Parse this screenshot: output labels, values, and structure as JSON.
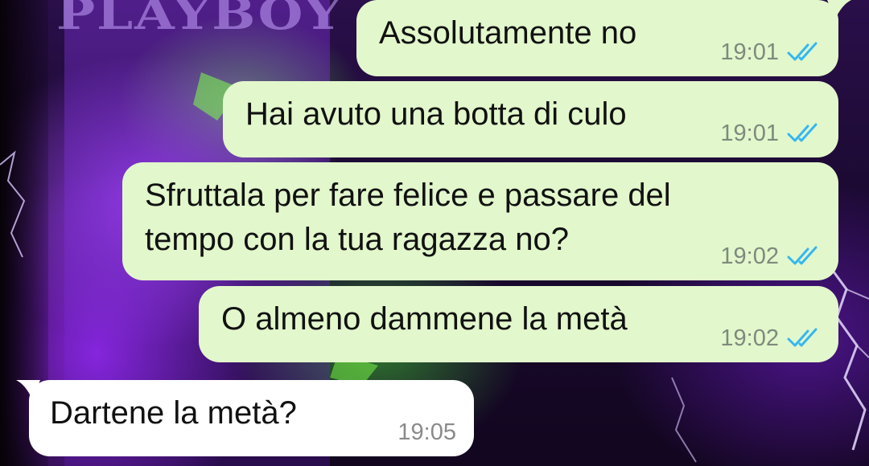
{
  "wallpaper": {
    "title": "PLAYBOY"
  },
  "colors": {
    "outgoing_bubble": "#e2f7cb",
    "incoming_bubble": "#ffffff",
    "read_ticks": "#34b7f1",
    "timestamp": "#7e8a7e"
  },
  "messages": [
    {
      "direction": "outgoing",
      "text": "Assolutamente no",
      "time": "19:01",
      "status_icon": "double-check-read-icon"
    },
    {
      "direction": "outgoing",
      "text": "Hai avuto una botta di culo",
      "time": "19:01",
      "status_icon": "double-check-read-icon"
    },
    {
      "direction": "outgoing",
      "text": "Sfruttala per fare felice e passare del\ntempo con la tua ragazza no?",
      "time": "19:02",
      "status_icon": "double-check-read-icon"
    },
    {
      "direction": "outgoing",
      "text": "O almeno dammene la metà",
      "time": "19:02",
      "status_icon": "double-check-read-icon"
    },
    {
      "direction": "incoming",
      "text": "Dartene la metà?",
      "time": "19:05"
    }
  ]
}
